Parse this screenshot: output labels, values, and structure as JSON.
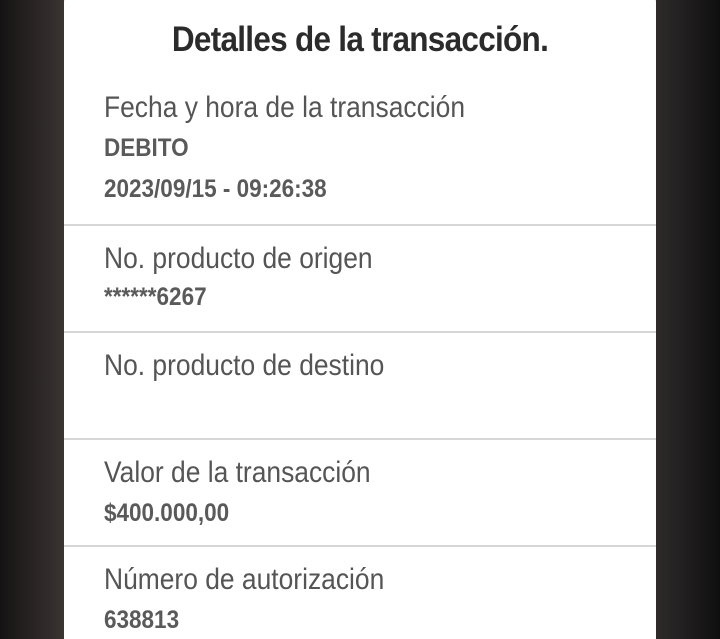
{
  "modal": {
    "title": "Detalles de la transacción.",
    "rows": [
      {
        "label": "Fecha y hora de la transacción",
        "type": "DEBITO",
        "value": "2023/09/15 - 09:26:38"
      },
      {
        "label": "No. producto de origen",
        "value": "******6267"
      },
      {
        "label": "No. producto de destino",
        "value": ""
      },
      {
        "label": "Valor de la transacción",
        "value": "$400.000,00"
      },
      {
        "label": "Número de autorización",
        "value": "638813"
      }
    ]
  }
}
